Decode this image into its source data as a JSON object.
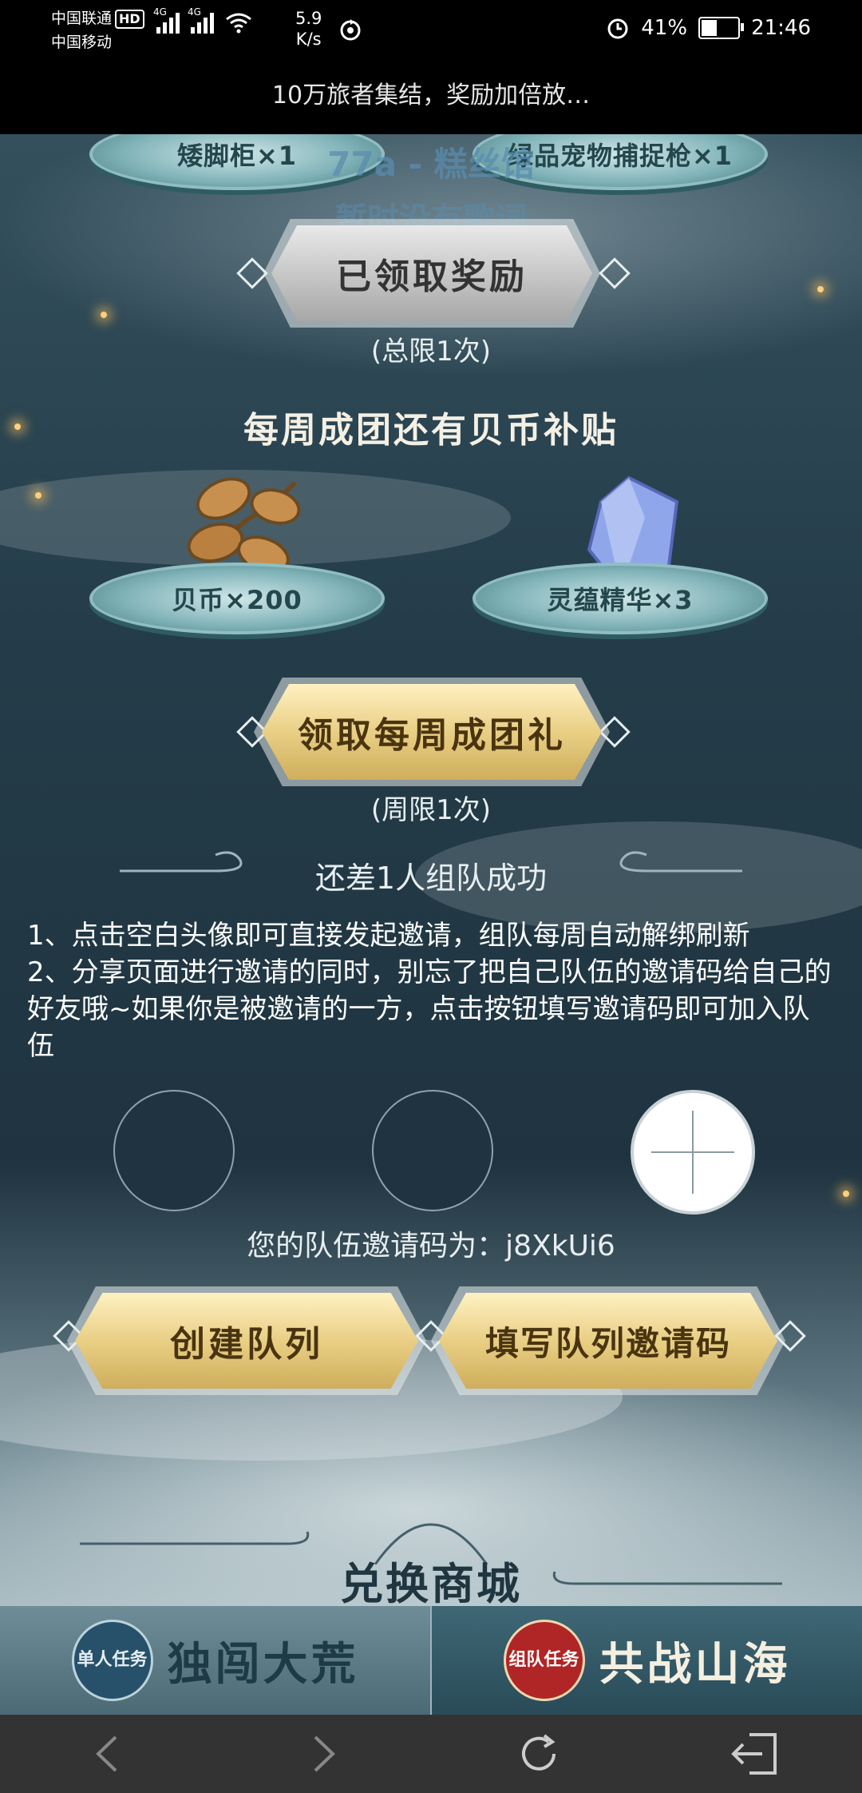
{
  "status_bar": {
    "carrier1": "中国联通",
    "hd": "HD",
    "carrier2": "中国移动",
    "net1": "4G",
    "net2": "4G",
    "speed_value": "5.9",
    "speed_unit": "K/s",
    "battery": "41%",
    "time": "21:46"
  },
  "page_title": "10万旅者集结，奖励加倍放…",
  "lyrics": {
    "line1": "77a - 糕丝馆",
    "line2": "暂时没有歌词"
  },
  "top_rewards": [
    {
      "label": "矮脚柜×1"
    },
    {
      "label": "绿品宠物捕捉枪×1"
    }
  ],
  "claimed_button": {
    "label": "已领取奖励",
    "limit": "(总限1次)"
  },
  "weekly": {
    "heading": "每周成团还有贝币补贴",
    "rewards": [
      {
        "label": "贝币×200",
        "icon": "shell-icon"
      },
      {
        "label": "灵蕴精华×3",
        "icon": "crystal-icon"
      }
    ],
    "claim_button": "领取每周成团礼",
    "limit": "(周限1次)"
  },
  "team": {
    "status": "还差1人组队成功",
    "rules": [
      "1、点击空白头像即可直接发起邀请，组队每周自动解绑刷新",
      "2、分享页面进行邀请的同时，别忘了把自己队伍的邀请码给自己的好友哦~如果你是被邀请的一方，点击按钮填写邀请码即可加入队伍"
    ],
    "invite_code_text": "您的队伍邀请码为：j8XkUi6",
    "create_button": "创建队列",
    "join_button": "填写队列邀请码"
  },
  "shop_heading": "兑换商城",
  "tabs": [
    {
      "badge": "单人任务",
      "label": "独闯大荒"
    },
    {
      "badge": "组队任务",
      "label": "共战山海"
    }
  ]
}
